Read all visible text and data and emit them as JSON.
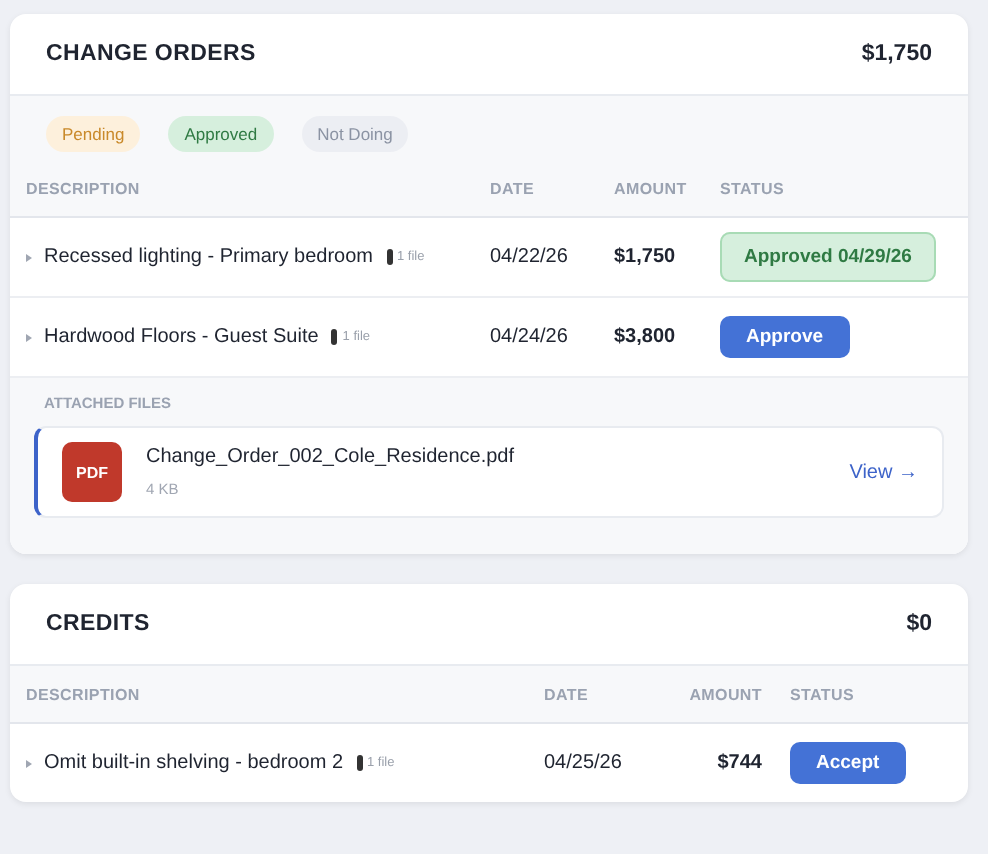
{
  "change_orders": {
    "title": "CHANGE ORDERS",
    "total": "$1,750",
    "filters": [
      {
        "label": "Pending",
        "kind": "pending"
      },
      {
        "label": "Approved",
        "kind": "approved"
      },
      {
        "label": "Not Doing",
        "kind": "not_doing"
      }
    ],
    "columns": [
      "DESCRIPTION",
      "DATE",
      "AMOUNT",
      "STATUS"
    ],
    "rows": [
      {
        "description": "Recessed lighting - Primary bedroom",
        "files": "1 file",
        "date": "04/22/26",
        "amount": "$1,750",
        "status": {
          "kind": "badge",
          "label": "Approved 04/29/26"
        }
      },
      {
        "description": "Hardwood Floors - Guest Suite",
        "files": "1 file",
        "date": "04/24/26",
        "amount": "$3,800",
        "status": {
          "kind": "button",
          "label": "Approve"
        }
      }
    ],
    "attached_files": {
      "heading": "ATTACHED FILES",
      "files": [
        {
          "type": "PDF",
          "name": "Change_Order_002_Cole_Residence.pdf",
          "size": "4 KB",
          "action": "View →"
        }
      ]
    }
  },
  "credits": {
    "title": "CREDITS",
    "total": "$0",
    "columns": [
      "DESCRIPTION",
      "DATE",
      "AMOUNT",
      "STATUS"
    ],
    "rows": [
      {
        "description": "Omit built-in shelving - bedroom 2",
        "files": "1 file",
        "date": "04/25/26",
        "amount": "$744",
        "status": {
          "kind": "button",
          "label": "Accept"
        }
      }
    ]
  }
}
